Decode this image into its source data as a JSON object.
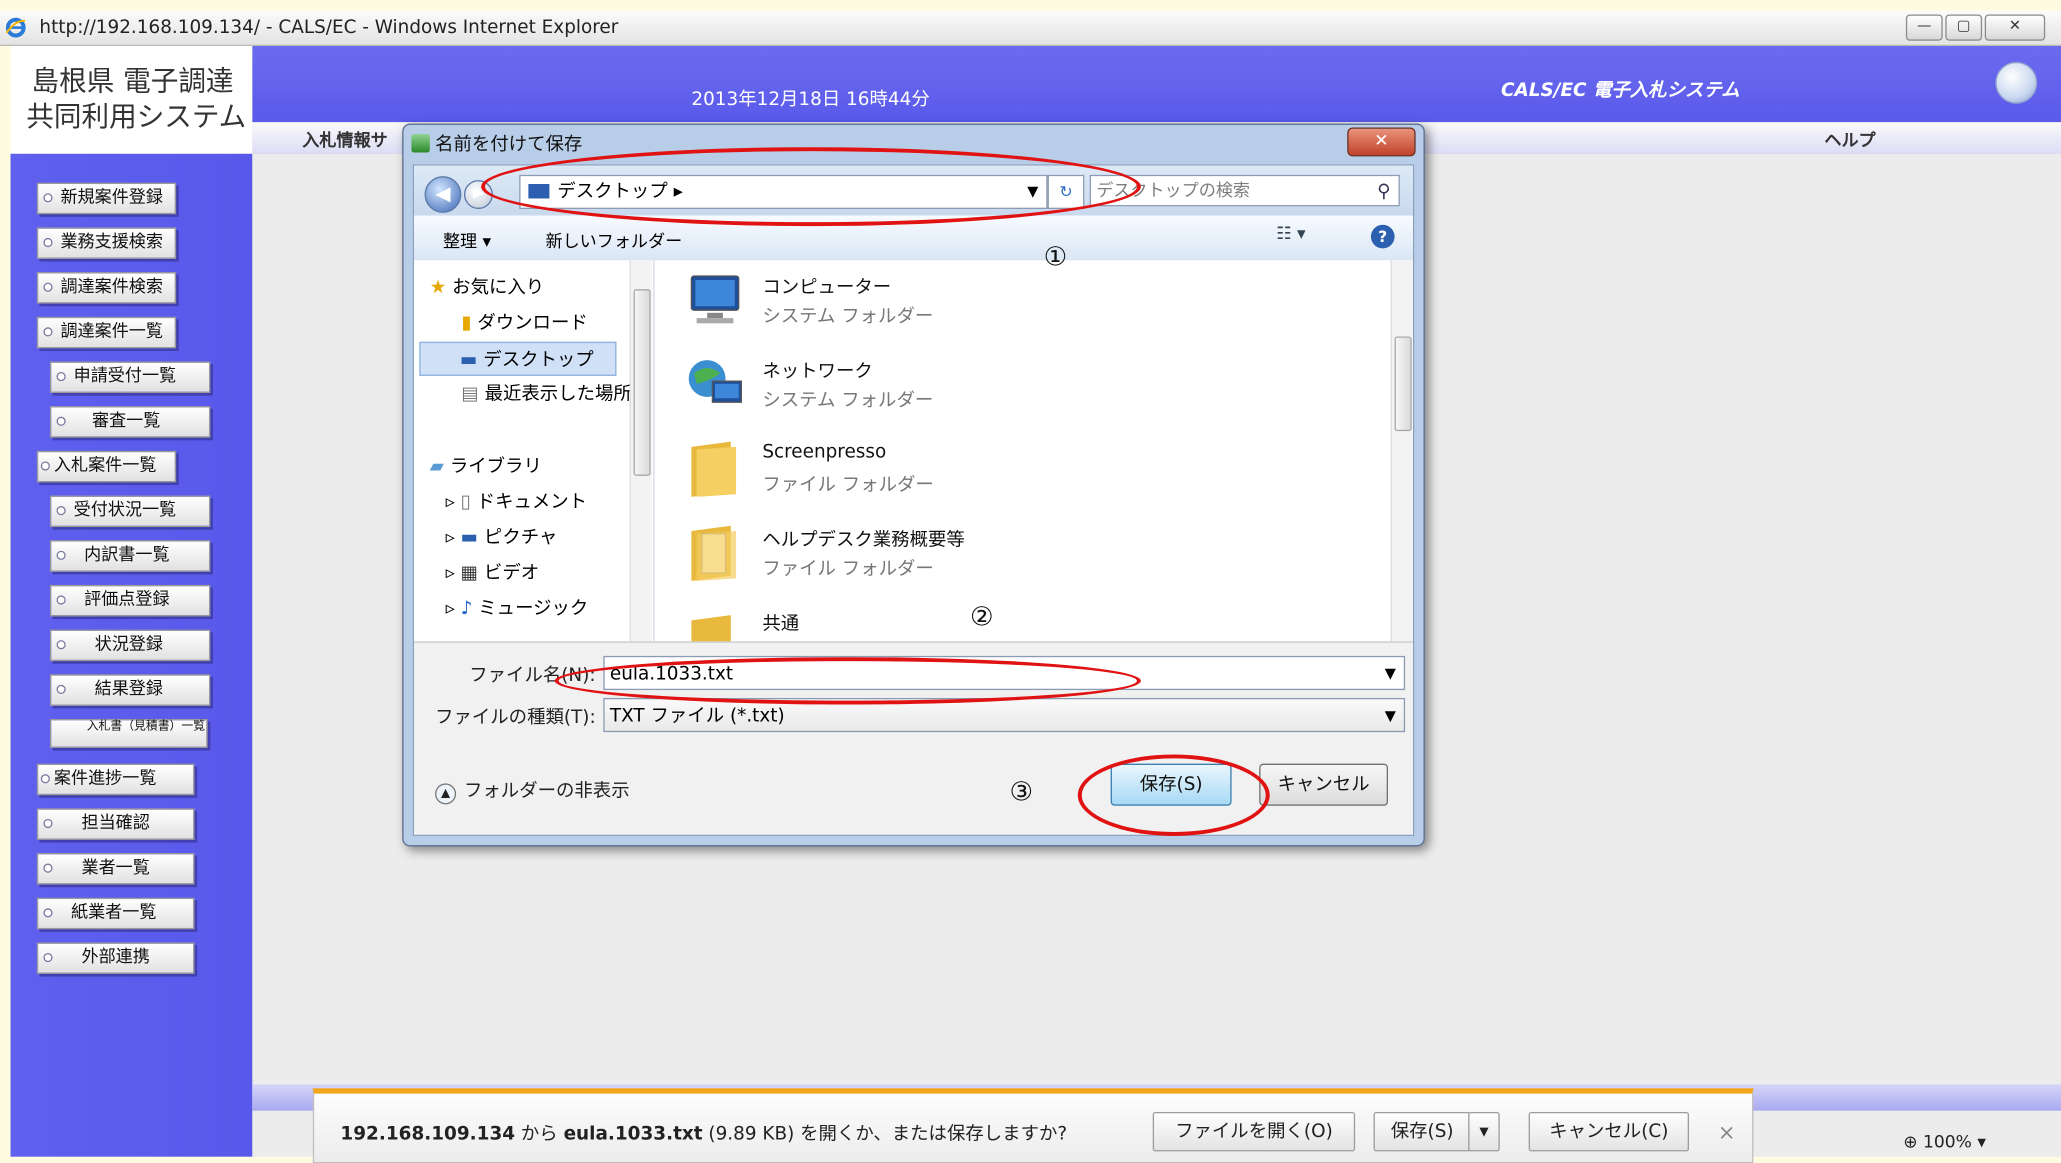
{
  "window": {
    "title": "http://192.168.109.134/ - CALS/EC - Windows Internet Explorer",
    "buttons": {
      "minimize": "—",
      "restore": "▢",
      "close": "✕"
    }
  },
  "app": {
    "logo_line1": "島根県 電子調達",
    "logo_line2": "共同利用システム",
    "datetime": "2013年12月18日 16時44分",
    "system_name": "CALS/EC 電子入札システム",
    "tab_label": "入札情報サ",
    "help": "ヘルプ",
    "sidebar": [
      {
        "label": "新規案件登録"
      },
      {
        "label": "業務支援検索"
      },
      {
        "label": "調達案件検索"
      },
      {
        "label": "調達案件一覧"
      },
      {
        "label": "申請受付一覧"
      },
      {
        "label": "審査一覧"
      },
      {
        "label": "入札案件一覧"
      },
      {
        "label": "受付状況一覧"
      },
      {
        "label": "内訳書一覧"
      },
      {
        "label": "評価点登録"
      },
      {
        "label": "状況登録"
      },
      {
        "label": "結果登録"
      },
      {
        "label": "入札書（見積書）一覧"
      },
      {
        "label": "案件進捗一覧"
      },
      {
        "label": "担当確認"
      },
      {
        "label": "業者一覧"
      },
      {
        "label": "紙業者一覧"
      },
      {
        "label": "外部連携"
      }
    ]
  },
  "dialog": {
    "title": "名前を付けて保存",
    "close": "✕",
    "address": "デスクトップ",
    "address_chevron": "▸",
    "search_placeholder": "デスクトップの検索",
    "toolbar": {
      "organize": "整理 ▾",
      "new_folder": "新しいフォルダー"
    },
    "nav": {
      "favorites": "お気に入り",
      "downloads": "ダウンロード",
      "desktop": "デスクトップ",
      "recent": "最近表示した場所",
      "libraries": "ライブラリ",
      "documents": "ドキュメント",
      "pictures": "ピクチャ",
      "videos": "ビデオ",
      "music": "ミュージック"
    },
    "files": [
      {
        "name": "コンピューター",
        "type": "システム フォルダー",
        "icon": "computer-icon"
      },
      {
        "name": "ネットワーク",
        "type": "システム フォルダー",
        "icon": "network-icon"
      },
      {
        "name": "Screenpresso",
        "type": "ファイル フォルダー",
        "icon": "folder-icon"
      },
      {
        "name": "ヘルプデスク業務概要等",
        "type": "ファイル フォルダー",
        "icon": "folder-icon"
      },
      {
        "name": "共通",
        "type": "",
        "icon": "folder-icon"
      }
    ],
    "filename_label": "ファイル名(N):",
    "filename_value": "eula.1033.txt",
    "filetype_label": "ファイルの種類(T):",
    "filetype_value": "TXT ファイル (*.txt)",
    "hide_folders": "フォルダーの非表示",
    "save": "保存(S)",
    "cancel": "キャンセル"
  },
  "annotations": {
    "n1": "①",
    "n2": "②",
    "n3": "③",
    "color": "#e01212"
  },
  "notification": {
    "host": "192.168.109.134",
    "from": " から ",
    "file": "eula.1033.txt",
    "rest": " (9.89 KB) を開くか、または保存しますか?",
    "open": "ファイルを開く(O)",
    "save": "保存(S)",
    "save_dropdown": "▾",
    "cancel": "キャンセル(C)",
    "close": "×"
  },
  "zoom": "100%",
  "colors": {
    "sidebar": "#5c5cec",
    "header": "#6363ee",
    "accent_warning": "#f4a61a"
  }
}
